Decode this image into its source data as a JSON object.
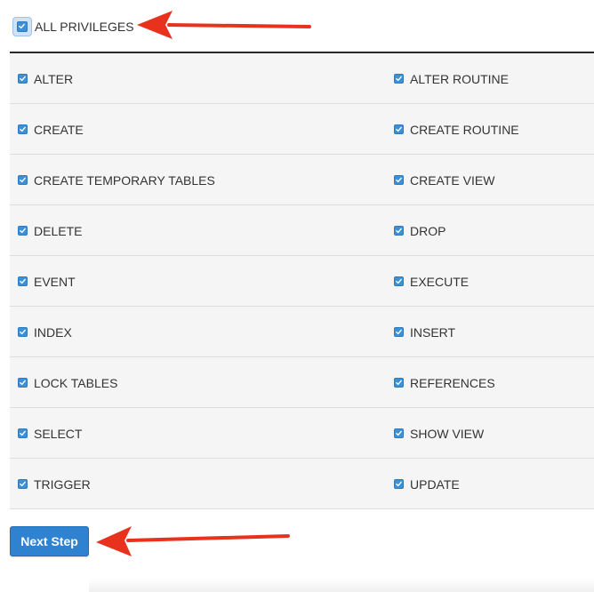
{
  "all_privileges": {
    "label": "ALL PRIVILEGES",
    "checked": true
  },
  "privileges": [
    {
      "left": {
        "label": "ALTER",
        "checked": true
      },
      "right": {
        "label": "ALTER ROUTINE",
        "checked": true
      }
    },
    {
      "left": {
        "label": "CREATE",
        "checked": true
      },
      "right": {
        "label": "CREATE ROUTINE",
        "checked": true
      }
    },
    {
      "left": {
        "label": "CREATE TEMPORARY TABLES",
        "checked": true
      },
      "right": {
        "label": "CREATE VIEW",
        "checked": true
      }
    },
    {
      "left": {
        "label": "DELETE",
        "checked": true
      },
      "right": {
        "label": "DROP",
        "checked": true
      }
    },
    {
      "left": {
        "label": "EVENT",
        "checked": true
      },
      "right": {
        "label": "EXECUTE",
        "checked": true
      }
    },
    {
      "left": {
        "label": "INDEX",
        "checked": true
      },
      "right": {
        "label": "INSERT",
        "checked": true
      }
    },
    {
      "left": {
        "label": "LOCK TABLES",
        "checked": true
      },
      "right": {
        "label": "REFERENCES",
        "checked": true
      }
    },
    {
      "left": {
        "label": "SELECT",
        "checked": true
      },
      "right": {
        "label": "SHOW VIEW",
        "checked": true
      }
    },
    {
      "left": {
        "label": "TRIGGER",
        "checked": true
      },
      "right": {
        "label": "UPDATE",
        "checked": true
      }
    }
  ],
  "next_button": {
    "label": "Next Step"
  },
  "colors": {
    "accent": "#2e82cf",
    "checkbox": "#3d8fd6",
    "arrow": "#e8321e",
    "row_bg": "#f5f5f5"
  },
  "icons": {
    "checkbox": "checkmark-icon",
    "annotation": "red-arrow-icon"
  }
}
